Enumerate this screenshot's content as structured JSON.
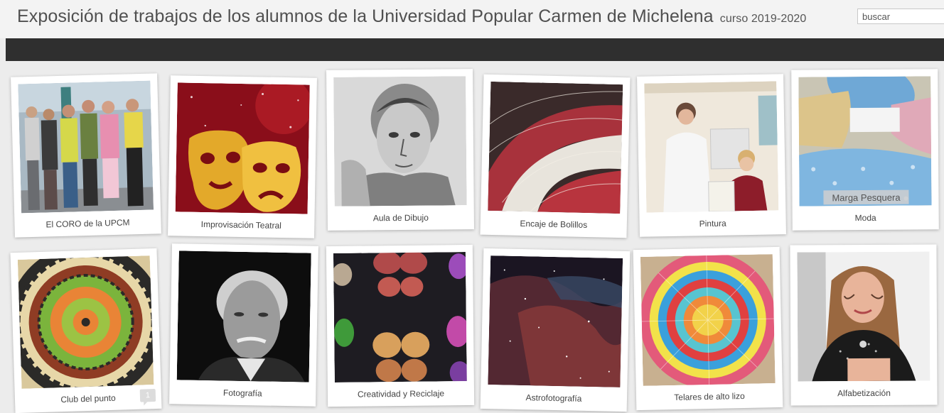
{
  "header": {
    "title": "Exposición de trabajos de los alumnos de la Universidad Popular Carmen de Michelena",
    "subtitle": "curso 2019-2020",
    "search_placeholder": "buscar"
  },
  "gallery": [
    {
      "caption": "El CORO de la UPCM",
      "icon": "choir-photo"
    },
    {
      "caption": "Improvisación Teatral",
      "icon": "theater-masks-image"
    },
    {
      "caption": "Aula de Dibujo",
      "icon": "pencil-portrait-drawing"
    },
    {
      "caption": "Encaje de Bolillos",
      "icon": "bobbin-lace-image"
    },
    {
      "caption": "Pintura",
      "icon": "painting-class-photo"
    },
    {
      "caption": "Moda",
      "icon": "fabric-masks-photo",
      "watermark": "Marga Pesquera"
    },
    {
      "caption": "Club del punto",
      "icon": "crochet-doily-image",
      "comment_count": "1"
    },
    {
      "caption": "Fotografía",
      "icon": "bw-portrait-photo"
    },
    {
      "caption": "Creatividad y Reciclaje",
      "icon": "recycled-butterflies-image"
    },
    {
      "caption": "Astrofotografía",
      "icon": "nebula-image"
    },
    {
      "caption": "Telares de alto lizo",
      "icon": "woven-circle-image"
    },
    {
      "caption": "Alfabetización",
      "icon": "woman-portrait-photo"
    }
  ]
}
